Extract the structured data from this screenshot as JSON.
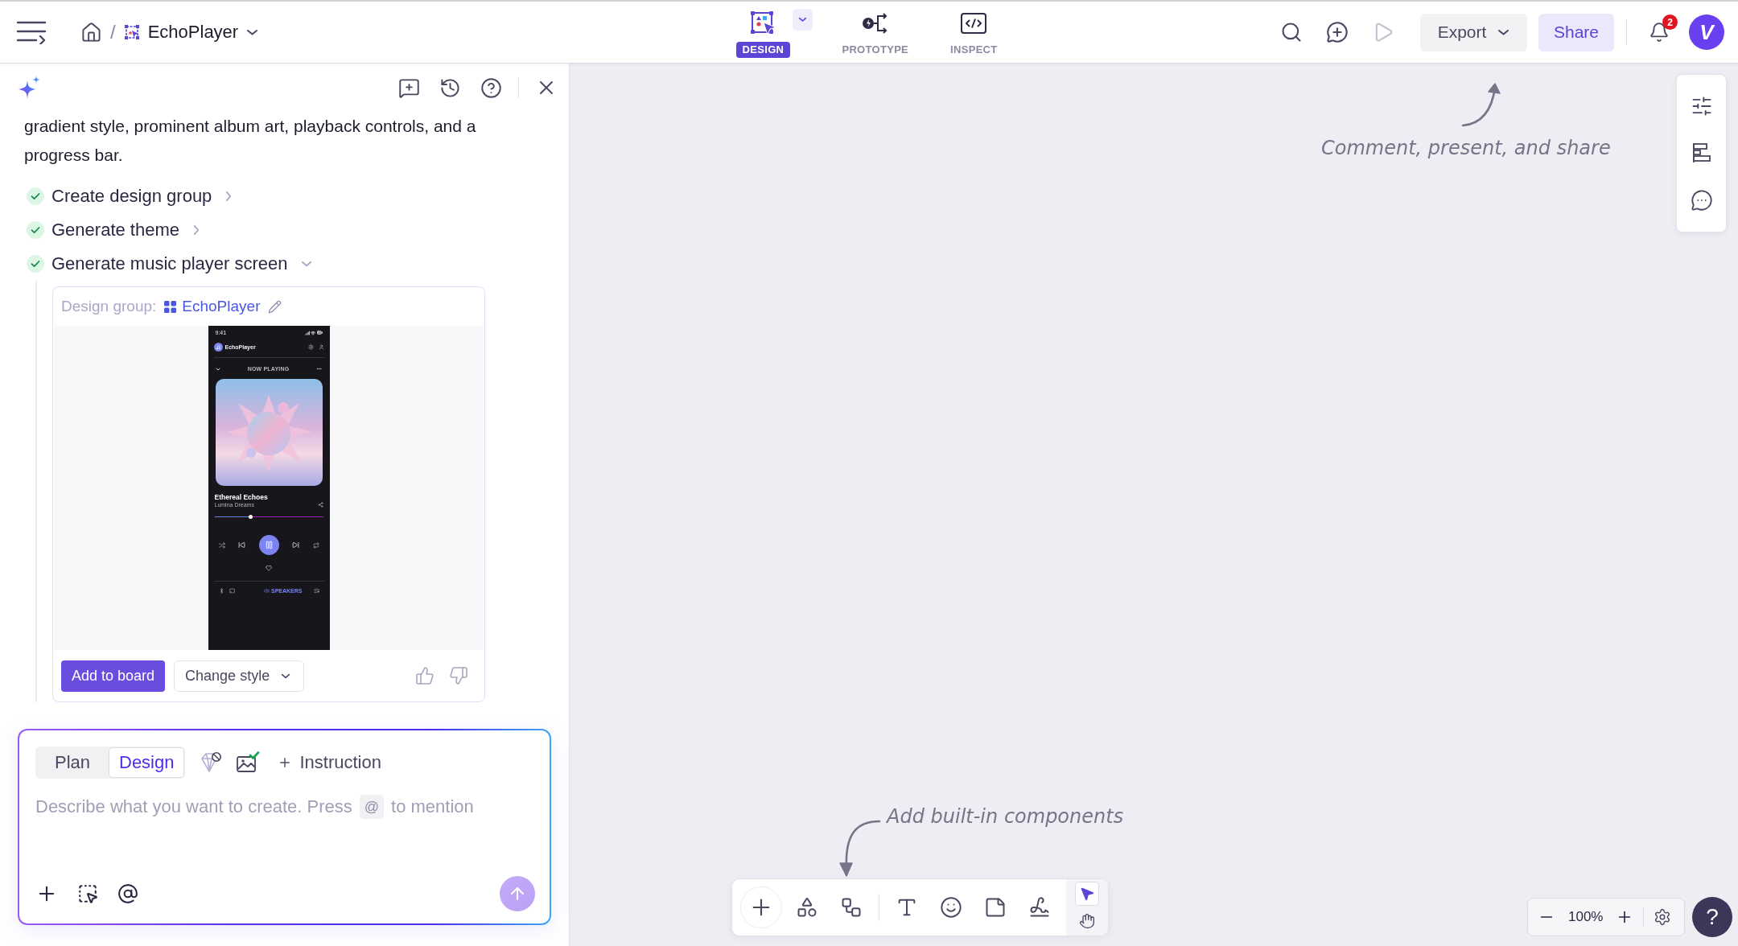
{
  "topbar": {
    "breadcrumb": {
      "separator": "/",
      "project": "EchoPlayer"
    },
    "modes": [
      {
        "kind": "design",
        "label": "DESIGN",
        "selected": true
      },
      {
        "kind": "prototype",
        "label": "PROTOTYPE",
        "selected": false
      },
      {
        "kind": "inspect",
        "label": "INSPECT",
        "selected": false
      }
    ],
    "actions": [
      {
        "kind": "search",
        "disabled": false
      },
      {
        "kind": "comment",
        "disabled": false
      },
      {
        "kind": "play",
        "disabled": true
      }
    ],
    "export_button": "Export",
    "share_button": "Share",
    "notifications": {
      "count": "2"
    },
    "avatar": {
      "initial": "V"
    }
  },
  "assistant": {
    "message": "gradient style, prominent album art, playback controls, and a progress bar.",
    "steps": [
      {
        "label": "Create design group",
        "done": true,
        "expanded": false
      },
      {
        "label": "Generate theme",
        "done": true,
        "expanded": false
      },
      {
        "label": "Generate music player screen",
        "done": true,
        "expanded": true
      }
    ],
    "result": {
      "group_label": "Design group:",
      "group_name": "EchoPlayer",
      "preview": {
        "time": "9:41",
        "app_name": "EchoPlayer",
        "section": "NOW PLAYING",
        "track_title": "Ethereal Echoes",
        "artist": "Lumina Dreams",
        "level": 0.33,
        "output": "SPEAKERS"
      },
      "add_button": "Add to board",
      "style_button": "Change style"
    },
    "composer": {
      "modes": [
        {
          "label": "Plan",
          "selected": false
        },
        {
          "label": "Design",
          "selected": true
        }
      ],
      "instruction_button": "Instruction",
      "placeholder": {
        "before": "Describe what you want to create. Press",
        "key": "@",
        "after": "to mention"
      },
      "send": {
        "disabled": true
      }
    }
  },
  "canvas": {
    "annotations": [
      {
        "kind": "up",
        "text": "Comment, present, and share"
      },
      {
        "kind": "down",
        "text": "Add built-in components"
      }
    ],
    "tools": [
      {
        "kind": "add"
      },
      {
        "kind": "shapes"
      },
      {
        "kind": "flow"
      },
      {
        "kind": "text"
      },
      {
        "kind": "emoji"
      },
      {
        "kind": "sticky"
      },
      {
        "kind": "pen"
      }
    ],
    "pointer_modes": [
      {
        "kind": "select",
        "selected": true
      },
      {
        "kind": "hand",
        "selected": false
      }
    ],
    "zoom": {
      "reading": "100%"
    },
    "help_button": "?"
  }
}
